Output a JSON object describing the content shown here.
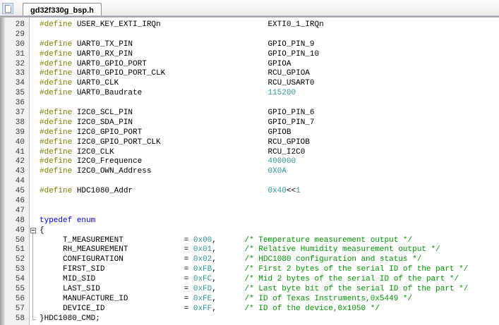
{
  "window": {
    "tab_title": "gd32f330g_bsp.h",
    "file_icon": "document-icon"
  },
  "colors": {
    "preprocessor": "#808000",
    "keyword": "#0000ff",
    "number": "#2f9699",
    "comment": "#009600",
    "plain": "#000000",
    "line_number": "#3a3a3a",
    "gutter_bg": "#f1f1f1",
    "tabbar_border": "#8f919c"
  },
  "editor": {
    "first_line_number": 28,
    "lines": [
      {
        "no": "28",
        "seg": [
          [
            "pp",
            "#define"
          ],
          [
            "p",
            " USER_KEY_EXTI_IRQn"
          ],
          [
            "p",
            "EXTI0_1_IRQn",
            49
          ]
        ]
      },
      {
        "no": "29",
        "seg": []
      },
      {
        "no": "30",
        "seg": [
          [
            "pp",
            "#define"
          ],
          [
            "p",
            " UART0_TX_PIN"
          ],
          [
            "p",
            "GPIO_PIN_9",
            49
          ]
        ]
      },
      {
        "no": "31",
        "seg": [
          [
            "pp",
            "#define"
          ],
          [
            "p",
            " UART0_RX_PIN"
          ],
          [
            "p",
            "GPIO_PIN_10",
            49
          ]
        ]
      },
      {
        "no": "32",
        "seg": [
          [
            "pp",
            "#define"
          ],
          [
            "p",
            " UART0_GPIO_PORT"
          ],
          [
            "p",
            "GPIOA",
            49
          ]
        ]
      },
      {
        "no": "33",
        "seg": [
          [
            "pp",
            "#define"
          ],
          [
            "p",
            " UART0_GPIO_PORT_CLK"
          ],
          [
            "p",
            "RCU_GPIOA",
            49
          ]
        ]
      },
      {
        "no": "34",
        "seg": [
          [
            "pp",
            "#define"
          ],
          [
            "p",
            " UART0_CLK"
          ],
          [
            "p",
            "RCU_USART0",
            49
          ]
        ]
      },
      {
        "no": "35",
        "seg": [
          [
            "pp",
            "#define"
          ],
          [
            "p",
            " UART0_Baudrate"
          ],
          [
            "n",
            "115200",
            49
          ]
        ]
      },
      {
        "no": "36",
        "seg": []
      },
      {
        "no": "37",
        "seg": [
          [
            "pp",
            "#define"
          ],
          [
            "p",
            " I2C0_SCL_PIN"
          ],
          [
            "p",
            "GPIO_PIN_6",
            49
          ]
        ]
      },
      {
        "no": "38",
        "seg": [
          [
            "pp",
            "#define"
          ],
          [
            "p",
            " I2C0_SDA_PIN"
          ],
          [
            "p",
            "GPIO_PIN_7",
            49
          ]
        ]
      },
      {
        "no": "39",
        "seg": [
          [
            "pp",
            "#define"
          ],
          [
            "p",
            " I2C0_GPIO_PORT"
          ],
          [
            "p",
            "GPIOB",
            49
          ]
        ]
      },
      {
        "no": "40",
        "seg": [
          [
            "pp",
            "#define"
          ],
          [
            "p",
            " I2C0_GPIO_PORT_CLK"
          ],
          [
            "p",
            "RCU_GPIOB",
            49
          ]
        ]
      },
      {
        "no": "41",
        "seg": [
          [
            "pp",
            "#define"
          ],
          [
            "p",
            " I2C0_CLK"
          ],
          [
            "p",
            "RCU_I2C0",
            49
          ]
        ]
      },
      {
        "no": "42",
        "seg": [
          [
            "pp",
            "#define"
          ],
          [
            "p",
            " I2C0_Frequence"
          ],
          [
            "n",
            "400000",
            49
          ]
        ]
      },
      {
        "no": "43",
        "seg": [
          [
            "pp",
            "#define"
          ],
          [
            "p",
            " I2C0_OWN_Address"
          ],
          [
            "n",
            "0X0A",
            49
          ]
        ]
      },
      {
        "no": "44",
        "seg": []
      },
      {
        "no": "45",
        "seg": [
          [
            "pp",
            "#define"
          ],
          [
            "p",
            " HDC1080_Addr"
          ],
          [
            "n",
            "0x40",
            49
          ],
          [
            "p",
            "<<"
          ],
          [
            "n",
            "1"
          ]
        ]
      },
      {
        "no": "46",
        "seg": []
      },
      {
        "no": "47",
        "seg": []
      },
      {
        "no": "48",
        "seg": [
          [
            "k",
            "typedef"
          ],
          [
            "p",
            " "
          ],
          [
            "k",
            "enum"
          ]
        ]
      },
      {
        "no": "49",
        "fold": "open",
        "seg": [
          [
            "p",
            "{"
          ]
        ]
      },
      {
        "no": "50",
        "fold": "line",
        "seg": [
          [
            "p",
            "T_MEASUREMENT",
            5
          ],
          [
            "p",
            "= ",
            31
          ],
          [
            "n",
            "0x00"
          ],
          [
            "p",
            ","
          ],
          [
            "c",
            "/* Temperature measurement output */",
            44
          ]
        ]
      },
      {
        "no": "51",
        "fold": "line",
        "seg": [
          [
            "p",
            "RH_MEASUREMENT",
            5
          ],
          [
            "p",
            "= ",
            31
          ],
          [
            "n",
            "0x01"
          ],
          [
            "p",
            ","
          ],
          [
            "c",
            "/* Relative Humidity measurement output */",
            44
          ]
        ]
      },
      {
        "no": "52",
        "fold": "line",
        "seg": [
          [
            "p",
            "CONFIGURATION",
            5
          ],
          [
            "p",
            "= ",
            31
          ],
          [
            "n",
            "0x02"
          ],
          [
            "p",
            ","
          ],
          [
            "c",
            "/* HDC1080 configuration and status */",
            44
          ]
        ]
      },
      {
        "no": "53",
        "fold": "line",
        "seg": [
          [
            "p",
            "FIRST_SID",
            5
          ],
          [
            "p",
            "= ",
            31
          ],
          [
            "n",
            "0xFB"
          ],
          [
            "p",
            ","
          ],
          [
            "c",
            "/* First 2 bytes of the serial ID of the part */",
            44
          ]
        ]
      },
      {
        "no": "54",
        "fold": "line",
        "seg": [
          [
            "p",
            "MID_SID",
            5
          ],
          [
            "p",
            "= ",
            31
          ],
          [
            "n",
            "0xFC"
          ],
          [
            "p",
            ","
          ],
          [
            "c",
            "/* Mid 2 bytes of the serial ID of the part */",
            44
          ]
        ]
      },
      {
        "no": "55",
        "fold": "line",
        "seg": [
          [
            "p",
            "LAST_SID",
            5
          ],
          [
            "p",
            "= ",
            31
          ],
          [
            "n",
            "0xFD"
          ],
          [
            "p",
            ","
          ],
          [
            "c",
            "/* Last byte bit of the serial ID of the part */",
            44
          ]
        ]
      },
      {
        "no": "56",
        "fold": "line",
        "seg": [
          [
            "p",
            "MANUFACTURE_ID",
            5
          ],
          [
            "p",
            "= ",
            31
          ],
          [
            "n",
            "0xFE"
          ],
          [
            "p",
            ","
          ],
          [
            "c",
            "/* ID of Texas Instruments,0x5449 */",
            44
          ]
        ]
      },
      {
        "no": "57",
        "fold": "line",
        "seg": [
          [
            "p",
            "DEVICE_ID",
            5
          ],
          [
            "p",
            "= ",
            31
          ],
          [
            "n",
            "0xFF"
          ],
          [
            "p",
            ","
          ],
          [
            "c",
            "/* ID of the device,0x1050 */",
            44
          ]
        ]
      },
      {
        "no": "58",
        "fold": "end",
        "seg": [
          [
            "p",
            "}HDC1080_CMD;"
          ]
        ]
      }
    ]
  }
}
